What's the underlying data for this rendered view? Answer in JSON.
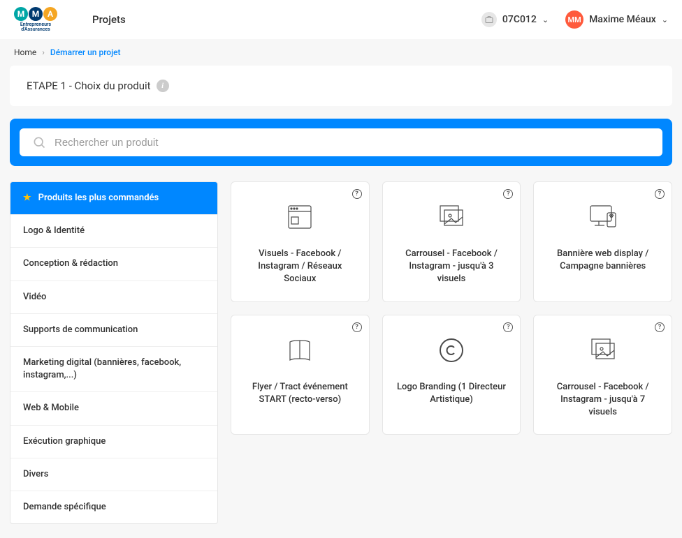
{
  "header": {
    "logo_letters": [
      "M",
      "M",
      "A"
    ],
    "logo_colors": [
      "#00a6a6",
      "#003a70",
      "#f5a623"
    ],
    "logo_tagline": "Entrepreneurs\nd'Assurances",
    "nav_projets": "Projets",
    "account_code": "07C012",
    "user_initials": "MM",
    "user_name": "Maxime Méaux",
    "avatar_color": "#ff5a3c"
  },
  "breadcrumb": {
    "home": "Home",
    "current": "Démarrer un projet"
  },
  "step": {
    "label": "ETAPE 1 - Choix du produit"
  },
  "search": {
    "placeholder": "Rechercher un produit"
  },
  "sidebar": {
    "items": [
      {
        "label": "Produits les plus commandés",
        "active": true
      },
      {
        "label": "Logo & Identité"
      },
      {
        "label": "Conception & rédaction"
      },
      {
        "label": "Vidéo"
      },
      {
        "label": "Supports de communication"
      },
      {
        "label": "Marketing digital (bannières, facebook, instagram,...)"
      },
      {
        "label": "Web & Mobile"
      },
      {
        "label": "Exécution graphique"
      },
      {
        "label": "Divers"
      },
      {
        "label": "Demande spécifique"
      }
    ]
  },
  "cards": [
    {
      "title": "Visuels - Facebook / Instagram / Réseaux Sociaux",
      "icon": "browser-icon"
    },
    {
      "title": "Carrousel - Facebook / Instagram - jusqu'à 3 visuels",
      "icon": "images-icon"
    },
    {
      "title": "Bannière web display / Campagne bannières",
      "icon": "devices-icon"
    },
    {
      "title": "Flyer / Tract événement START (recto-verso)",
      "icon": "book-icon"
    },
    {
      "title": "Logo Branding (1 Directeur Artistique)",
      "icon": "copyright-icon"
    },
    {
      "title": "Carrousel - Facebook / Instagram - jusqu'à 7 visuels",
      "icon": "images-icon"
    }
  ]
}
